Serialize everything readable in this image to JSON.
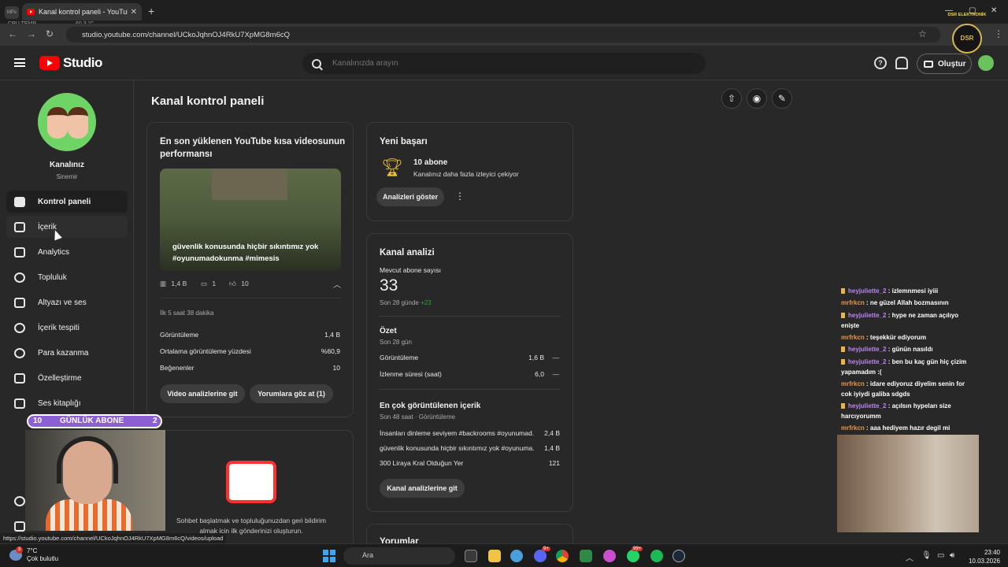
{
  "browser": {
    "tab_title": "Kanal kontrol paneli - YouTube",
    "url": "studio.youtube.com/channel/UCkoJqhnOJ4RkU7XpMG8m6cQ",
    "cpu_label": "CPU TEMP",
    "cpu_value": "60.3 °C",
    "status_url": "https://studio.youtube.com/channel/UCkoJqhnOJ4RkU7XpMG8m6cQ/videos/upload",
    "mini_tab": "MPs"
  },
  "header": {
    "logo": "Studio",
    "search_placeholder": "Kanalınızda arayın",
    "create_label": "Oluştur"
  },
  "sidebar": {
    "channel_name": "Kanalınız",
    "channel_sub": "Sinemir",
    "items": [
      {
        "label": "Kontrol paneli"
      },
      {
        "label": "İçerik"
      },
      {
        "label": "Analytics"
      },
      {
        "label": "Topluluk"
      },
      {
        "label": "Altyazı ve ses"
      },
      {
        "label": "İçerik tespiti"
      },
      {
        "label": "Para kazanma"
      },
      {
        "label": "Özelleştirme"
      },
      {
        "label": "Ses kitaplığı"
      }
    ]
  },
  "main": {
    "title": "Kanal kontrol paneli",
    "shorts_card": {
      "title": "En son yüklenen YouTube kısa videosunun performansı",
      "thumb_caption": "güvenlik konusunda hiçbir sıkıntımız yok #oyunumadokunma #mimesis",
      "views_stat": "1,4 B",
      "comments_stat": "1",
      "likes_stat": "10",
      "period": "İlk 5 saat 38 dakika",
      "rows": [
        {
          "label": "Görüntüleme",
          "value": "1,4 B"
        },
        {
          "label": "Ortalama görüntüleme yüzdesi",
          "value": "%60,9"
        },
        {
          "label": "Beğenenler",
          "value": "10"
        }
      ],
      "btn_analytics": "Video analizlerine git",
      "btn_comments": "Yorumlara göz at (1)"
    },
    "community_card": {
      "text": "Sohbet başlatmak ve topluluğunuzdan geri bildirim almak için ilk gönderinizi oluşturun."
    },
    "achievement_card": {
      "title": "Yeni başarı",
      "headline": "10 abone",
      "sub": "Kanalınız daha fazla izleyici çekiyor",
      "btn": "Analizleri göster"
    },
    "analytics_card": {
      "title": "Kanal analizi",
      "subs_label": "Mevcut abone sayısı",
      "subs_value": "33",
      "subs_period": "Son 28 günde",
      "subs_delta": "+23",
      "summary_title": "Özet",
      "summary_period": "Son 28 gün",
      "summary_rows": [
        {
          "label": "Görüntüleme",
          "value": "1,6 B",
          "trend": "—"
        },
        {
          "label": "İzlenme süresi (saat)",
          "value": "6,0",
          "trend": "—"
        }
      ],
      "top_title": "En çok görüntülenen içerik",
      "top_period": "Son 48 saat · Görüntüleme",
      "top_rows": [
        {
          "label": "İnsanları dinleme seviyem #backrooms #oyunumad...",
          "value": "2,4 B"
        },
        {
          "label": "güvenlik konusunda hiçbir sıkıntımız yok #oyunuma...",
          "value": "1,4 B"
        },
        {
          "label": "300 Liraya Kral Olduğun Yer",
          "value": "121"
        }
      ],
      "btn": "Kanal analizlerine git"
    },
    "comments_card_title": "Yorumlar"
  },
  "overlay": {
    "sub_count": "10",
    "sub_label": "GÜNLÜK ABONE",
    "sub_goal": "2",
    "logo_text": "DSR ELEKTRONİK",
    "logo_mark": "DSR",
    "chat": [
      {
        "user": "heyjuliette_2",
        "text": ": izlemnmesi iyiii",
        "color": "purple"
      },
      {
        "user": "mrfrkcn",
        "text": ": ne güzel Allah bozmasının",
        "color": "orange"
      },
      {
        "user": "heyjuliette_2",
        "text": ": hype ne zaman açılıyo enişte",
        "color": "purple"
      },
      {
        "user": "mrfrkcn",
        "text": ": teşekkür ediyorum",
        "color": "orange"
      },
      {
        "user": "heyjuliette_2",
        "text": ": günün nasıldı",
        "color": "purple"
      },
      {
        "user": "heyjuliette_2",
        "text": ": ben bu kaç gün hiç çizim yapamadım :(",
        "color": "purple"
      },
      {
        "user": "mrfrkcn",
        "text": ": idare ediyoruz diyelim senin for cok iyiydi galiba sdgds",
        "color": "orange"
      },
      {
        "user": "heyjuliette_2",
        "text": ": açılsın hypeları size harcıyorumm",
        "color": "purple"
      },
      {
        "user": "mrfrkcn",
        "text": ": aaa hediyem hazır degil mi",
        "color": "orange"
      }
    ]
  },
  "taskbar": {
    "temp": "7°C",
    "weather": "Çok bulutlu",
    "search": "Ara",
    "time": "23:40",
    "date": "10.03.2026",
    "weather_badge": "3",
    "badge_discord": "9+",
    "badge_whatsapp": "99+"
  }
}
